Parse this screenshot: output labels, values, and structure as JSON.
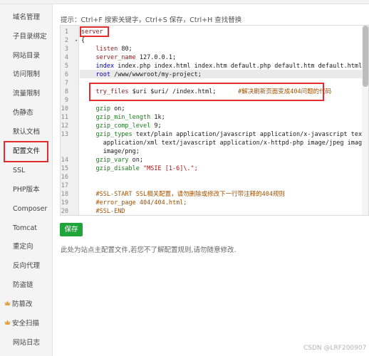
{
  "sidebar": {
    "items": [
      {
        "label": "域名管理"
      },
      {
        "label": "子目录绑定"
      },
      {
        "label": "网站目录"
      },
      {
        "label": "访问限制"
      },
      {
        "label": "流量限制"
      },
      {
        "label": "伪静态"
      },
      {
        "label": "默认文档"
      },
      {
        "label": "配置文件"
      },
      {
        "label": "SSL"
      },
      {
        "label": "PHP版本"
      },
      {
        "label": "Composer"
      },
      {
        "label": "Tomcat"
      },
      {
        "label": "重定向"
      },
      {
        "label": "反向代理"
      },
      {
        "label": "防盗链"
      },
      {
        "label": "防篡改",
        "icon": "crown-icon"
      },
      {
        "label": "安全扫描",
        "icon": "crown-icon"
      },
      {
        "label": "网站日志"
      }
    ],
    "active_index": 7
  },
  "editor": {
    "hint": "提示：Ctrl+F 搜索关键字，Ctrl+S 保存，Ctrl+H 查找替换",
    "line_numbers": [
      "1",
      "2",
      "3",
      "4",
      "5",
      "6",
      "7",
      "8",
      "9",
      "10",
      "11",
      "12",
      "13",
      "",
      "",
      "14",
      "15",
      "16",
      "17",
      "18",
      "19",
      "20"
    ],
    "code": {
      "l1": "server",
      "l2": "{",
      "l3_k": "listen",
      "l3_v": " 80;",
      "l4_k": "server_name",
      "l4_v": " 127.0.0.1;",
      "l5_k": "index",
      "l5_v": " index.php index.html index.htm default.php default.htm default.html;",
      "l6_k": "root",
      "l6_v": " /www/wwwroot/my-project",
      "l6_end": ";",
      "l8_k": "try_files",
      "l8_v": " $uri $uri/ /index.html;",
      "l8_c": "#解决刷新页面变成404问题的代码",
      "l10_k": "gzip",
      "l10_v": " on;",
      "l11_k": "gzip_min_length",
      "l11_v": " 1k;",
      "l12_k": "gzip_comp_level",
      "l12_v": " 9;",
      "l13_k": "gzip_types",
      "l13_v": " text/plain application/javascript application/x-javascript text/css",
      "l13b": "application/xml text/javascript application/x-httpd-php image/jpeg image/gif",
      "l13c": "image/png;",
      "l14_k": "gzip_vary",
      "l14_v": " on;",
      "l15_k": "gzip_disable",
      "l15_v": " \"MSIE [1-6]\\.\";",
      "l18": "#SSL-START SSL相关配置，请勿删除或修改下一行带注释的404规则",
      "l19": "#error_page 404/404.html;",
      "l20": "#SSL-END"
    }
  },
  "save_label": "保存",
  "note": "此处为站点主配置文件,若您不了解配置规则,请勿随意修改.",
  "watermark": "CSDN @LRF200907"
}
